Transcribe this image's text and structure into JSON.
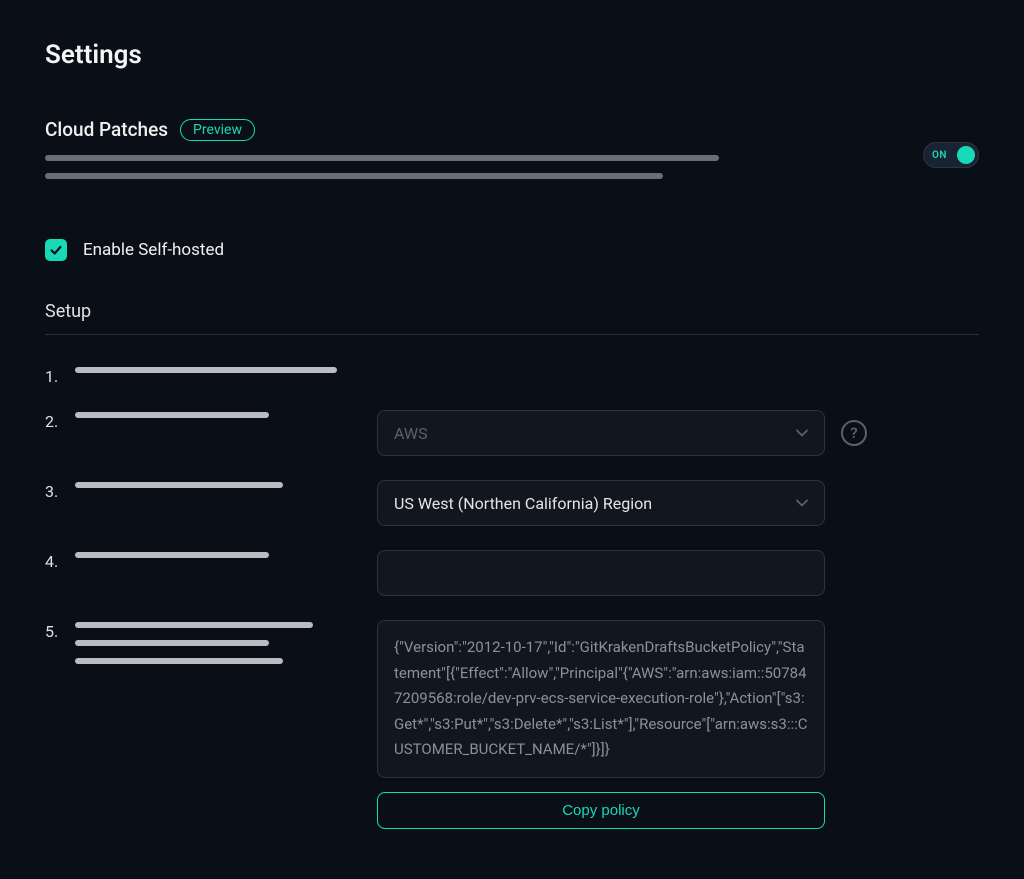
{
  "page": {
    "title": "Settings"
  },
  "cloudPatches": {
    "title": "Cloud Patches",
    "badge": "Preview",
    "toggle": {
      "state": "on",
      "label": "ON"
    }
  },
  "selfHosted": {
    "checked": true,
    "label": "Enable Self-hosted"
  },
  "setup": {
    "title": "Setup",
    "steps": {
      "provider": {
        "value": "AWS"
      },
      "region": {
        "value": "US West (Northen California) Region"
      },
      "bucket": {
        "value": ""
      },
      "policy": {
        "json": "{\"Version\":\"2012-10-17\",\"Id\":\"GitKrakenDraftsBucketPolicy\",\"Statement\"[{\"Effect\":\"Allow\",\"Principal\"{\"AWS\":\"arn:aws:iam::507847209568:role/dev-prv-ecs-service-execution-role\"},\"Action\"[\"s3:Get*\",\"s3:Put*\",\"s3:Delete*\",\"s3:List*\"],\"Resource\"[\"arn:aws:s3:::CUSTOMER_BUCKET_NAME/*\"]}]}",
        "copyLabel": "Copy policy"
      }
    }
  },
  "icons": {
    "help": "?"
  }
}
